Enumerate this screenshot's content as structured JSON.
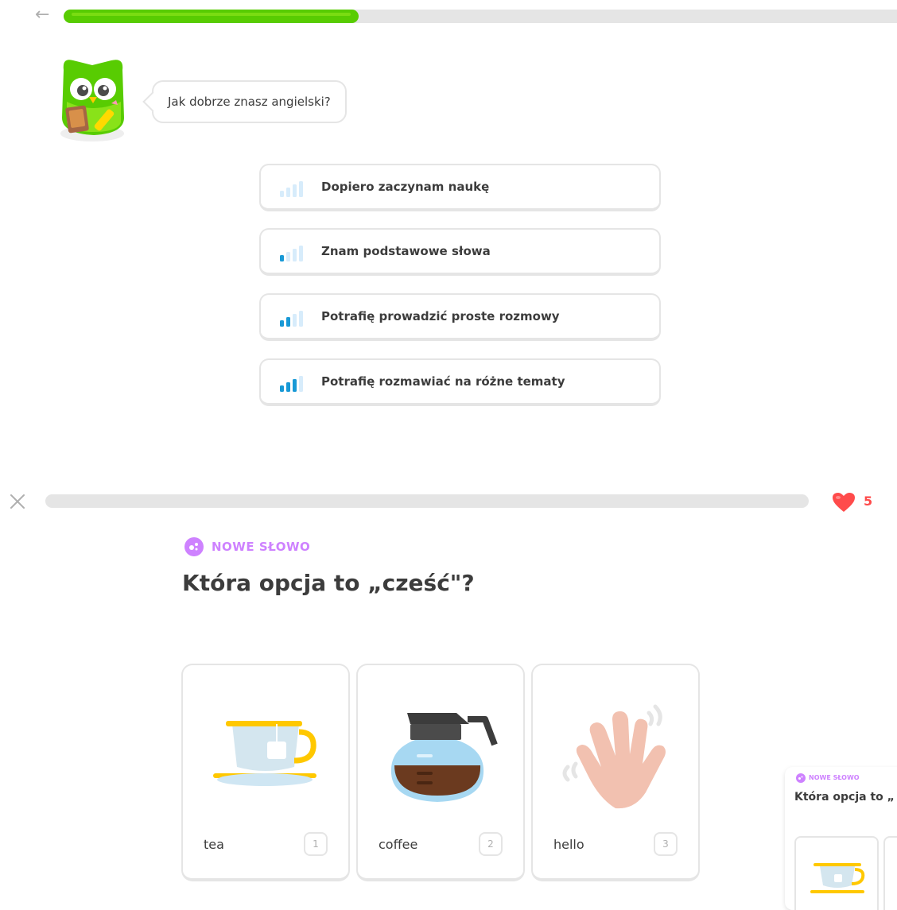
{
  "placement": {
    "progress_percent": 35,
    "prompt": "Jak dobrze znasz angielski?",
    "levels": [
      {
        "label": "Dopiero zaczynam naukę",
        "bars_filled": 0
      },
      {
        "label": "Znam podstawowe słowa",
        "bars_filled": 1
      },
      {
        "label": "Potrafię prowadzić proste rozmowy",
        "bars_filled": 2
      },
      {
        "label": "Potrafię rozmawiać na różne tematy",
        "bars_filled": 3
      }
    ]
  },
  "lesson": {
    "progress_percent": 0,
    "hearts": "5",
    "badge": "NOWE SŁOWO",
    "question": "Która opcja to „cześć\"?",
    "choices": [
      {
        "word": "tea",
        "key": "1",
        "icon": "teacup-icon"
      },
      {
        "word": "coffee",
        "key": "2",
        "icon": "coffee-pot-icon"
      },
      {
        "word": "hello",
        "key": "3",
        "icon": "waving-hand-icon"
      }
    ]
  },
  "preview": {
    "badge": "NOWE SŁOWO",
    "title": "Która opcja to „"
  },
  "colors": {
    "green": "#58cc02",
    "blue": "#1cb0f6",
    "purple": "#ce82ff",
    "red": "#ff4b4b",
    "border": "#e5e5e5"
  }
}
